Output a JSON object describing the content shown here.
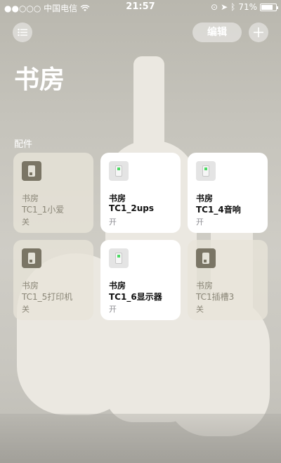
{
  "status_bar": {
    "carrier": "●●○○○ 中国电信",
    "time": "21:57",
    "battery": "71%",
    "battery_level": 0.71
  },
  "header": {
    "menu_icon": "list-icon",
    "edit_label": "编辑",
    "add_icon": "plus-icon",
    "title": "书房"
  },
  "section_label": "配件",
  "accessories": [
    {
      "room": "书房",
      "name": "TC1_1小爱",
      "state": "关",
      "on": false
    },
    {
      "room": "书房",
      "name": "TC1_2ups",
      "state": "开",
      "on": true
    },
    {
      "room": "书房",
      "name": "TC1_4音响",
      "state": "开",
      "on": true
    },
    {
      "room": "书房",
      "name": "TC1_5打印机",
      "state": "关",
      "on": false
    },
    {
      "room": "书房",
      "name": "TC1_6显示器",
      "state": "开",
      "on": true
    },
    {
      "room": "书房",
      "name": "TC1插槽3",
      "state": "关",
      "on": false
    }
  ],
  "colors": {
    "on_tile": "#ffffff",
    "off_tile": "#e8e4d8",
    "on_indicator": "#4cd964"
  }
}
